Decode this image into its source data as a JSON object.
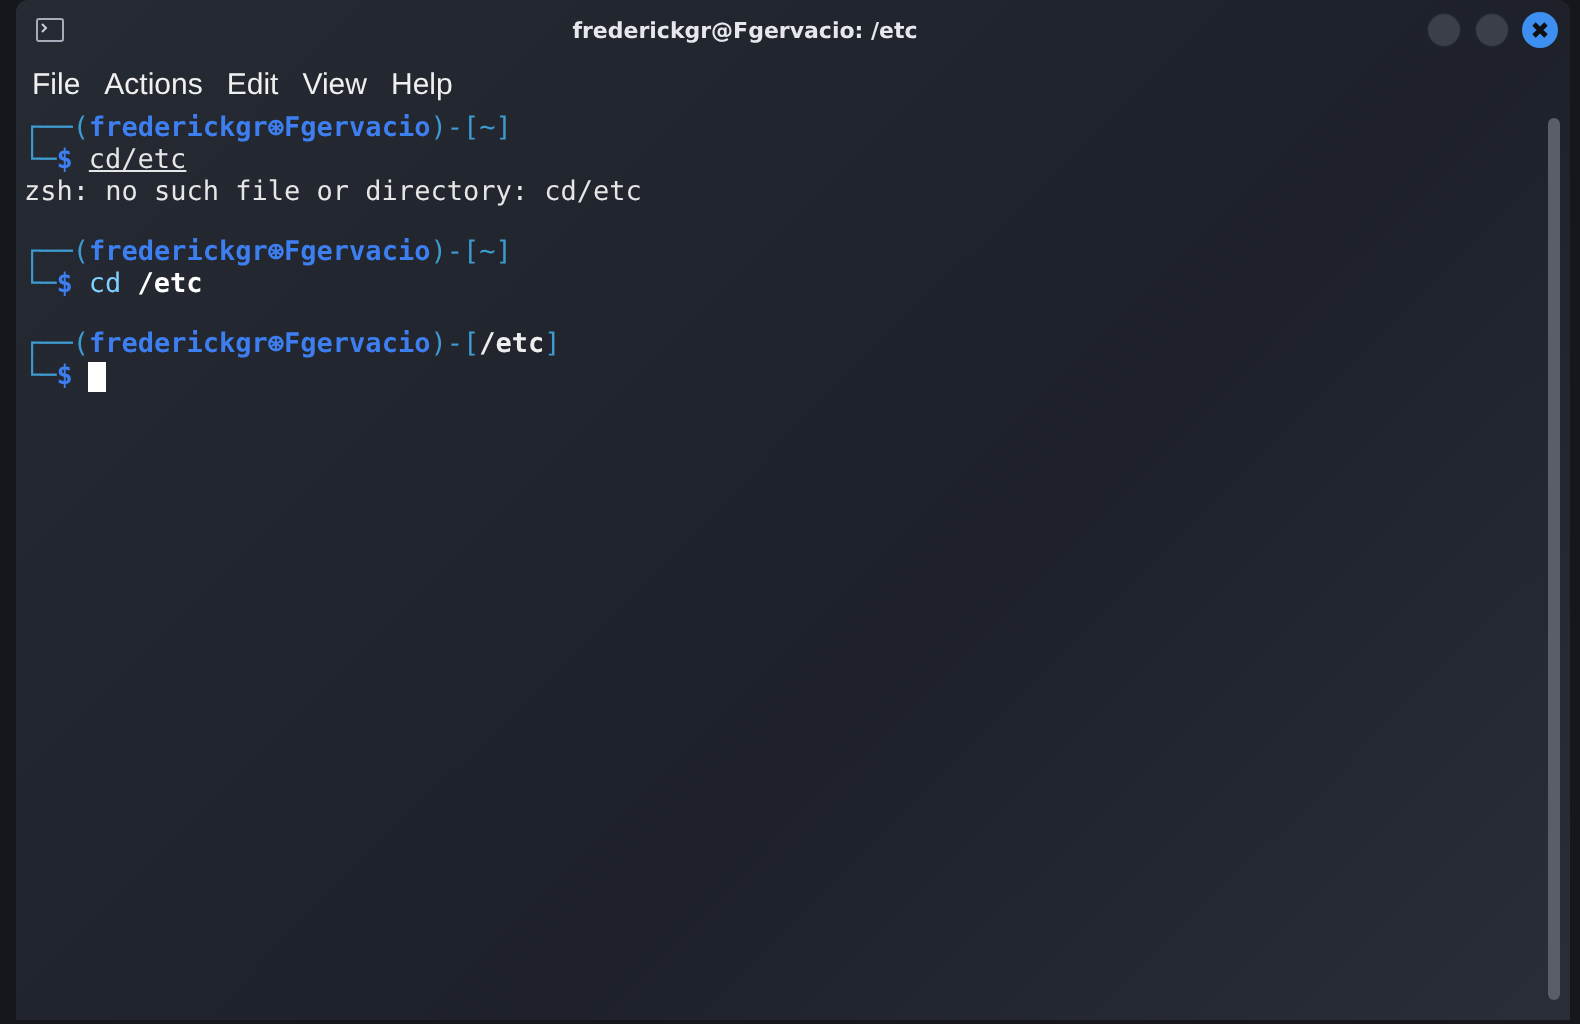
{
  "window": {
    "title": "frederickgr@Fgervacio: /etc"
  },
  "menu": [
    "File",
    "Actions",
    "Edit",
    "View",
    "Help"
  ],
  "blocks": [
    {
      "open": "┌──(",
      "identity": "frederickgr⊛Fgervacio",
      "mid": ")-[",
      "dir": "~",
      "close": "]",
      "corner": "└─",
      "symbol": "$",
      "command": "cd/etc",
      "underlined": true,
      "output": [
        "zsh: no such file or directory: cd/etc"
      ]
    },
    {
      "open": "┌──(",
      "identity": "frederickgr⊛Fgervacio",
      "mid": ")-[",
      "dir": "~",
      "close": "]",
      "corner": "└─",
      "symbol": "$",
      "command": "cd **/etc**",
      "underlined": false
    },
    {
      "open": "┌──(",
      "identity": "frederickgr⊛Fgervacio",
      "mid": ")-[",
      "dir": "**/etc**",
      "close": "]",
      "corner": "└─",
      "symbol": "$",
      "cursor": true
    }
  ]
}
